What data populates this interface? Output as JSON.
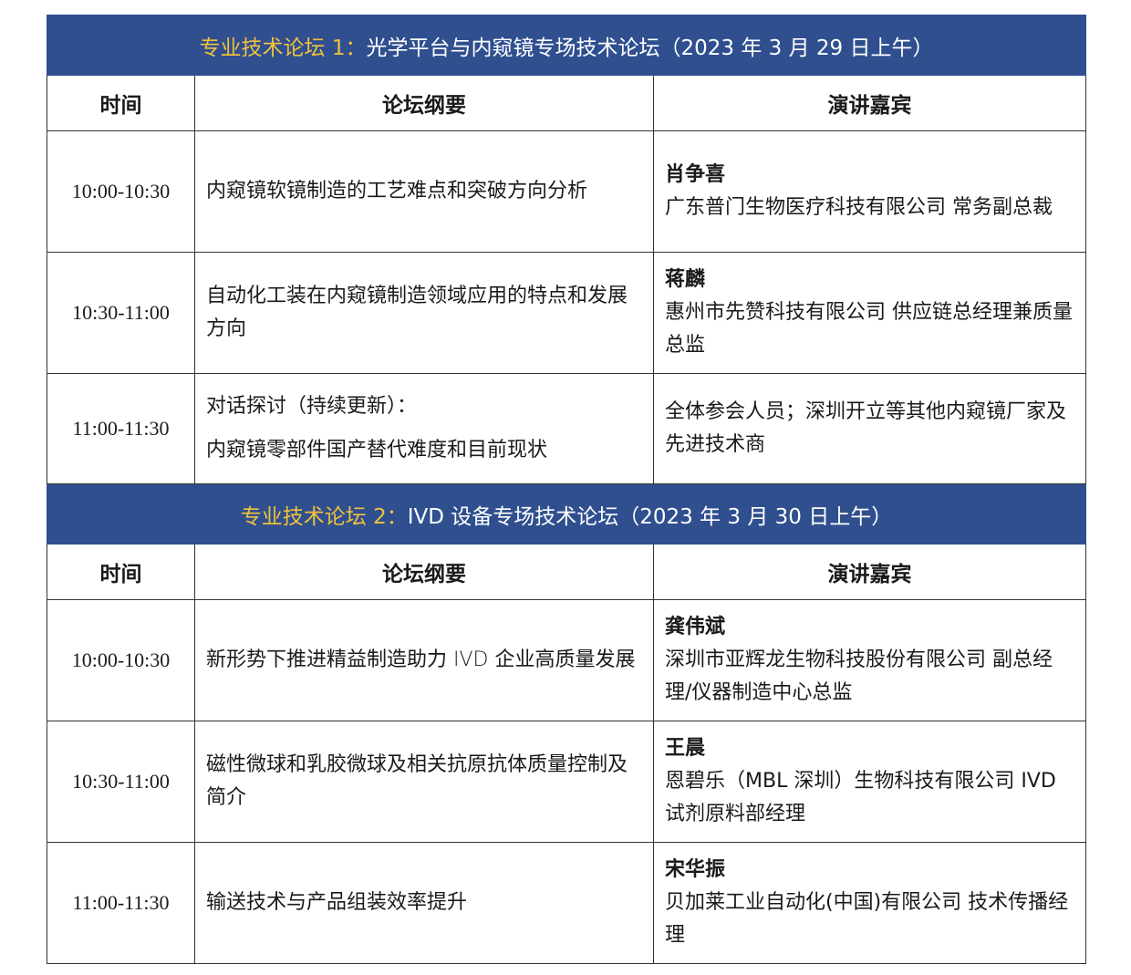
{
  "forums": [
    {
      "banner_lead": "专业技术论坛 1：",
      "banner_title": "光学平台与内窥镜专场技术论坛（2023 年 3 月 29 日上午）",
      "headers": [
        "时间",
        "论坛纲要",
        "演讲嘉宾"
      ],
      "sessions": [
        {
          "time": "10:00-10:30",
          "topic": "内窥镜软镜制造的工艺难点和突破方向分析",
          "speaker_name": "肖争喜",
          "speaker_org": "广东普门生物医疗科技有限公司  常务副总裁"
        },
        {
          "time": "10:30-11:00",
          "topic": "自动化工装在内窥镜制造领域应用的特点和发展方向",
          "speaker_name": "蒋麟",
          "speaker_org": "惠州市先赞科技有限公司  供应链总经理兼质量总监"
        },
        {
          "time": "11:00-11:30",
          "topic_line1": "对话探讨（持续更新）：",
          "topic_line2": "内窥镜零部件国产替代难度和目前现状",
          "speaker_org": "全体参会人员；深圳开立等其他内窥镜厂家及先进技术商"
        }
      ]
    },
    {
      "banner_lead": "专业技术论坛 2：",
      "banner_title": "IVD 设备专场技术论坛（2023 年 3 月 30 日上午）",
      "headers": [
        "时间",
        "论坛纲要",
        "演讲嘉宾"
      ],
      "sessions": [
        {
          "time": "10:00-10:30",
          "topic": "新形势下推进精益制造助力 IVD 企业高质量发展",
          "speaker_name": "龚伟斌",
          "speaker_org": "深圳市亚辉龙生物科技股份有限公司  副总经理/仪器制造中心总监"
        },
        {
          "time": "10:30-11:00",
          "topic": "磁性微球和乳胶微球及相关抗原抗体质量控制及简介",
          "speaker_name": "王晨",
          "speaker_org": "恩碧乐（MBL 深圳）生物科技有限公司 IVD 试剂原料部经理"
        },
        {
          "time": "11:00-11:30",
          "topic": "输送技术与产品组装效率提升",
          "speaker_name": "宋华振",
          "speaker_org": "贝加莱工业自动化(中国)有限公司  技术传播经理"
        }
      ]
    }
  ],
  "colors": {
    "banner_bg": "#2f4f8f",
    "banner_lead": "#f0c23c",
    "banner_text": "#ffffff"
  }
}
